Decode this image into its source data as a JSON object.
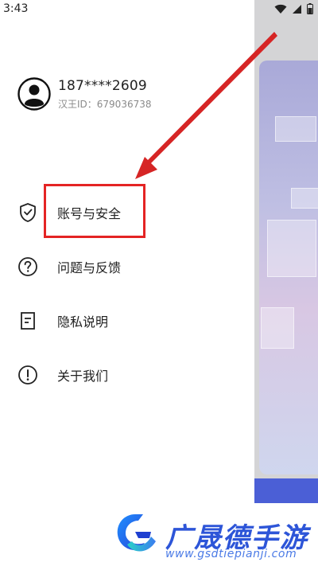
{
  "status_bar": {
    "time": "3:43"
  },
  "profile": {
    "phone": "187****2609",
    "uid": "汉王ID：679036738"
  },
  "menu": [
    {
      "label": "账号与安全",
      "icon": "shield-check-icon"
    },
    {
      "label": "问题与反馈",
      "icon": "question-circle-icon"
    },
    {
      "label": "隐私说明",
      "icon": "document-icon"
    },
    {
      "label": "关于我们",
      "icon": "info-exclamation-icon"
    }
  ],
  "annotation": {
    "highlight_color": "#e42424"
  },
  "watermark": {
    "title": "广晟德手游",
    "url": "www.gsdtiepianji.com"
  },
  "colors": {
    "accent": "#4b5fd6",
    "watermark_blue": "#2d55d8"
  }
}
